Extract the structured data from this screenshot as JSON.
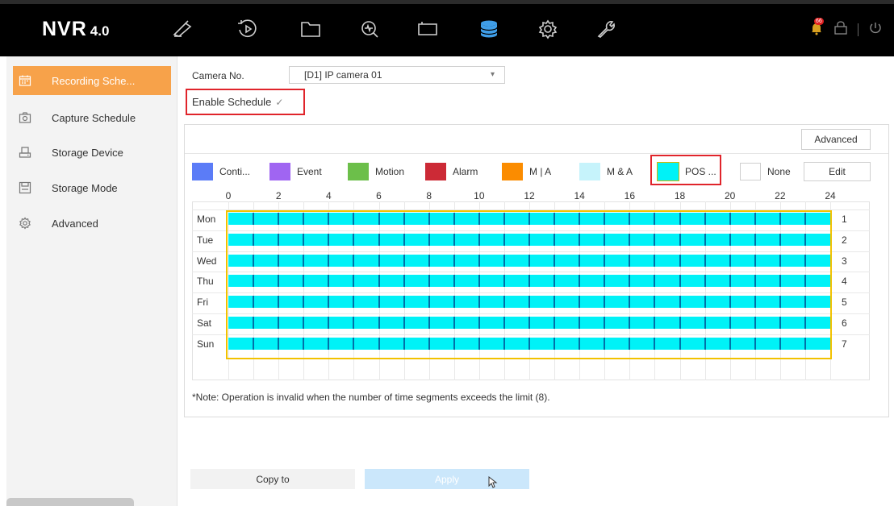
{
  "brand": {
    "name": "NVR",
    "version": "4.0"
  },
  "topnav": {
    "icons": [
      "live-view-icon",
      "playback-icon",
      "file-icon",
      "smart-analysis-icon",
      "display-icon",
      "storage-icon",
      "settings-icon",
      "maintenance-icon"
    ],
    "active": "storage-icon",
    "notification_count": "66"
  },
  "sidebar": {
    "items": [
      {
        "label": "Recording Sche...",
        "icon": "calendar-icon",
        "active": true
      },
      {
        "label": "Capture Schedule",
        "icon": "camera-icon",
        "active": false
      },
      {
        "label": "Storage Device",
        "icon": "storage-device-icon",
        "active": false
      },
      {
        "label": "Storage Mode",
        "icon": "disk-icon",
        "active": false
      },
      {
        "label": "Advanced",
        "icon": "gear-icon",
        "active": false
      }
    ]
  },
  "form": {
    "camera_label": "Camera No.",
    "camera_value": "[D1] IP camera 01",
    "enable_label": "Enable Schedule",
    "enable_checked": true
  },
  "buttons": {
    "advanced": "Advanced",
    "edit": "Edit",
    "copy_to": "Copy to",
    "apply": "Apply"
  },
  "legend": [
    {
      "label": "Conti...",
      "color": "#5b7cf7"
    },
    {
      "label": "Event",
      "color": "#a065f2"
    },
    {
      "label": "Motion",
      "color": "#6cbf4a"
    },
    {
      "label": "Alarm",
      "color": "#cc2a36"
    },
    {
      "label": "M | A",
      "color": "#fb8c00"
    },
    {
      "label": "M & A",
      "color": "#c6f3fb"
    },
    {
      "label": "POS ...",
      "color": "#00f2f7"
    },
    {
      "label": "None",
      "color": "#ffffff"
    }
  ],
  "schedule": {
    "hours": [
      "0",
      "2",
      "4",
      "6",
      "8",
      "10",
      "12",
      "14",
      "16",
      "18",
      "20",
      "22",
      "24"
    ],
    "days": [
      {
        "name": "Mon",
        "index": "1"
      },
      {
        "name": "Tue",
        "index": "2"
      },
      {
        "name": "Wed",
        "index": "3"
      },
      {
        "name": "Thu",
        "index": "4"
      },
      {
        "name": "Fri",
        "index": "5"
      },
      {
        "name": "Sat",
        "index": "6"
      },
      {
        "name": "Sun",
        "index": "7"
      }
    ],
    "segment_type": "POS",
    "segment_start_hour": 0,
    "segment_end_hour": 24
  },
  "note": "*Note: Operation is invalid when the number of time segments exceeds the limit (8)."
}
